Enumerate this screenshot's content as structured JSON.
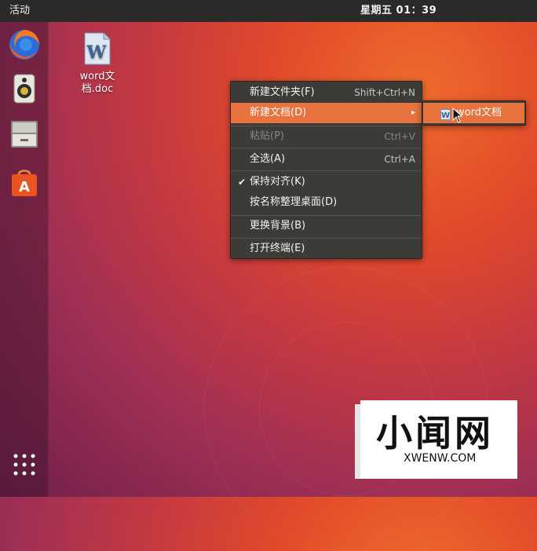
{
  "topbar": {
    "activities": "活动",
    "clock": "星期五 01：39"
  },
  "launcher": {
    "items": [
      "firefox-icon",
      "rhythmbox-icon",
      "files-icon",
      "software-center-icon",
      "show-apps-icon"
    ]
  },
  "desktop": {
    "file_name": "word文档.doc"
  },
  "context_menu": {
    "items": [
      {
        "label": "新建文件夹(F)",
        "shortcut": "Shift+Ctrl+N"
      },
      {
        "label": "新建文档(D)",
        "shortcut": "▸"
      },
      {
        "label": "粘贴(P)",
        "shortcut": "Ctrl+V"
      },
      {
        "label": "全选(A)",
        "shortcut": "Ctrl+A"
      },
      {
        "label": "保持对齐(K)",
        "check": "✔"
      },
      {
        "label": "按名称整理桌面(D)"
      },
      {
        "label": "更换背景(B)"
      },
      {
        "label": "打开终端(E)"
      }
    ],
    "submenu_item": "word文档"
  },
  "watermark": {
    "title": "小闻网",
    "domain": "XWENW.COM"
  },
  "colors": {
    "highlight": "#e9733f",
    "menu_bg": "#3c3b37",
    "topbar_bg": "#2b2a28"
  }
}
